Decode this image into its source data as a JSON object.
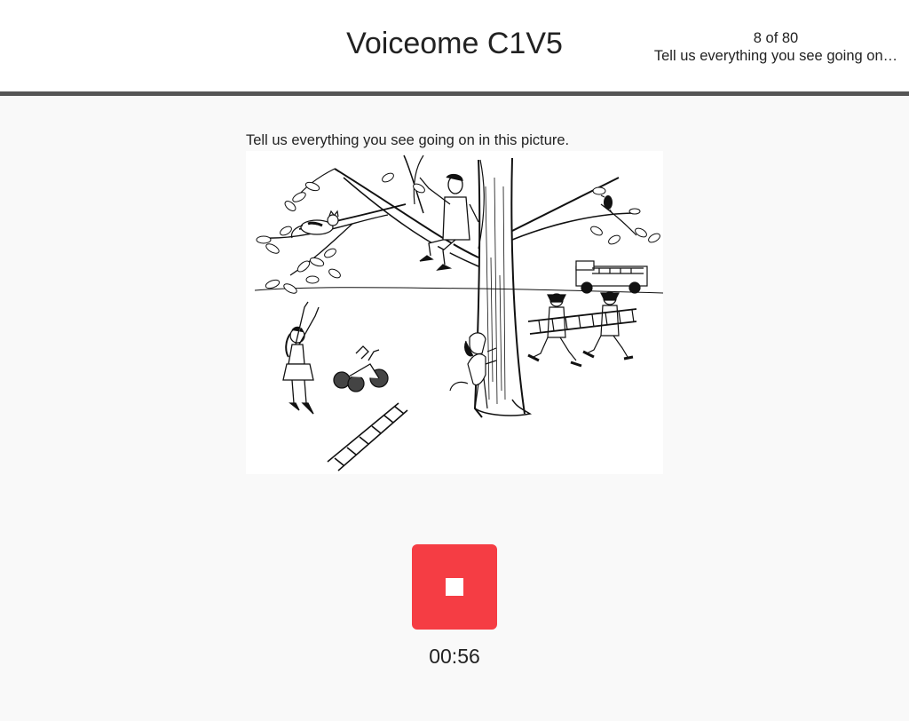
{
  "header": {
    "title": "Voiceome C1V5",
    "progress": "8 of 80",
    "task_label": "Tell us everything you see going on…"
  },
  "main": {
    "prompt": "Tell us everything you see going on in this picture.",
    "picture_icon": "cat-in-tree-picture"
  },
  "recorder": {
    "button_icon": "stop-icon",
    "button_color": "#f53d44",
    "timer": "00:56"
  }
}
